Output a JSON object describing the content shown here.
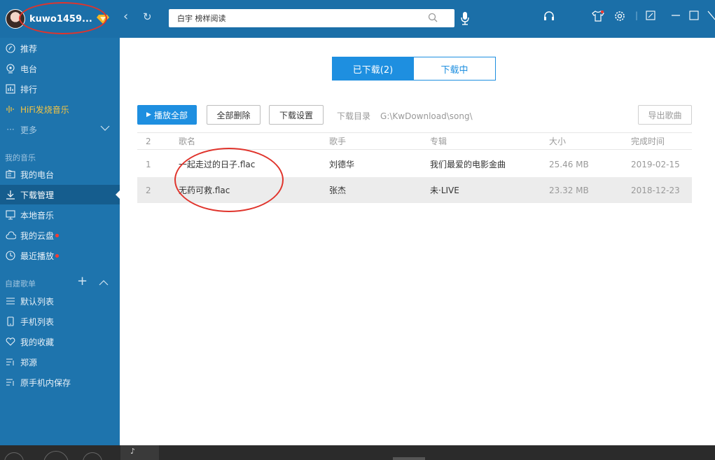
{
  "user": {
    "name": "kuwo1459..."
  },
  "search": {
    "placeholder": "白宇 榜样阅读"
  },
  "sidebar": {
    "items": [
      {
        "label": "推荐"
      },
      {
        "label": "电台"
      },
      {
        "label": "排行"
      },
      {
        "label": "HiFi发烧音乐"
      },
      {
        "label": "更多"
      }
    ],
    "my_music_title": "我的音乐",
    "my_music": [
      {
        "label": "我的电台"
      },
      {
        "label": "下载管理"
      },
      {
        "label": "本地音乐"
      },
      {
        "label": "我的云盘"
      },
      {
        "label": "最近播放"
      }
    ],
    "playlists_title": "自建歌单",
    "playlists": [
      {
        "label": "默认列表"
      },
      {
        "label": "手机列表"
      },
      {
        "label": "我的收藏"
      },
      {
        "label": "郑源"
      },
      {
        "label": "原手机内保存"
      }
    ]
  },
  "tabs": {
    "downloaded": "已下载(2)",
    "downloading": "下载中"
  },
  "toolbar": {
    "play_all": "播放全部",
    "delete_all": "全部删除",
    "settings": "下载设置",
    "dir_label": "下载目录",
    "dir_path": "G:\\KwDownload\\song\\",
    "export": "导出歌曲"
  },
  "table": {
    "count": "2",
    "headers": {
      "name": "歌名",
      "artist": "歌手",
      "album": "专辑",
      "size": "大小",
      "date": "完成时间"
    },
    "rows": [
      {
        "index": "1",
        "name": "一起走过的日子.flac",
        "artist": "刘德华",
        "album": "我们最爱的电影金曲",
        "size": "25.46 MB",
        "date": "2019-02-15"
      },
      {
        "index": "2",
        "name": "无药可救.flac",
        "artist": "张杰",
        "album": "未·LIVE",
        "size": "23.32 MB",
        "date": "2018-12-23"
      }
    ]
  },
  "colors": {
    "sidebar": "#1e74ad",
    "topbar": "#1b6fa8",
    "accent": "#1e8fe0",
    "annotation": "#e0342c"
  }
}
